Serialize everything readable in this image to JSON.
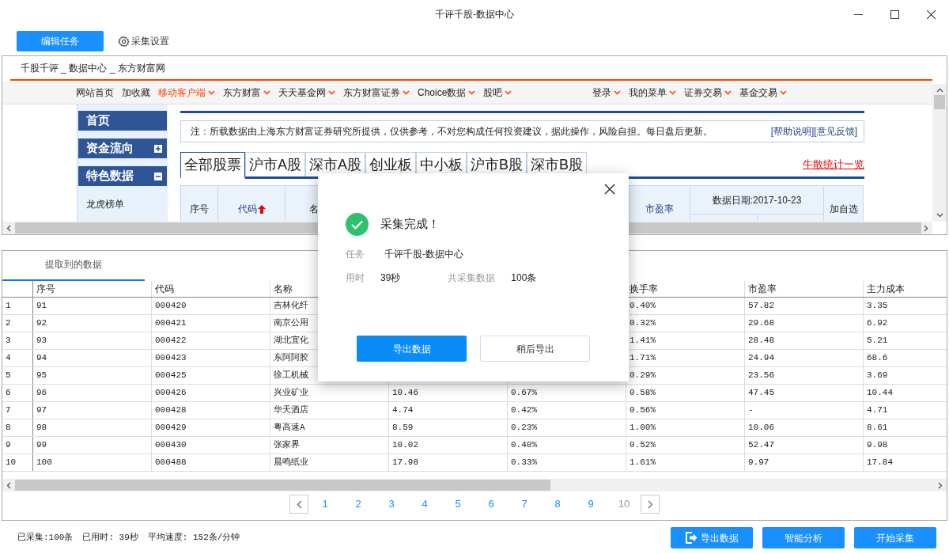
{
  "window": {
    "title": "千评千股-数据中心"
  },
  "toolbar": {
    "edit_button": "编辑任务",
    "settings_link": "采集设置"
  },
  "browser": {
    "page_title": "千股千评 _ 数据中心 _ 东方财富网",
    "nav_left": [
      {
        "label": "网站首页",
        "caret": false,
        "highlight": false
      },
      {
        "label": "加收藏",
        "caret": false,
        "highlight": false
      },
      {
        "label": "移动客户端",
        "caret": true,
        "highlight": true
      },
      {
        "label": "东方财富",
        "caret": true,
        "highlight": false
      },
      {
        "label": "天天基金网",
        "caret": true,
        "highlight": false
      },
      {
        "label": "东方财富证券",
        "caret": true,
        "highlight": false
      },
      {
        "label": "Choice数据",
        "caret": true,
        "highlight": false
      },
      {
        "label": "股吧",
        "caret": true,
        "highlight": false
      }
    ],
    "nav_right": [
      {
        "label": "登录",
        "caret": true,
        "highlight": false
      },
      {
        "label": "我的菜单",
        "caret": true,
        "highlight": false
      },
      {
        "label": "证券交易",
        "caret": true,
        "highlight": false
      },
      {
        "label": "基金交易",
        "caret": true,
        "highlight": false
      }
    ],
    "sidebar": [
      {
        "label": "首页",
        "kind": "header"
      },
      {
        "label": "资金流向",
        "kind": "header",
        "expanded": false
      },
      {
        "label": "特色数据",
        "kind": "header",
        "expanded": true
      },
      {
        "label": "龙虎榜单",
        "kind": "link"
      }
    ],
    "notice": "注：所载数据由上海东方财富证券研究所提供，仅供参考，不对您构成任何投资建议，据此操作，风险自担。每日盘后更新。",
    "notice_links": [
      "[帮助说明]",
      "[意见反馈]"
    ],
    "tabs": [
      {
        "label": "全部股票",
        "selected": true
      },
      {
        "label": "沪市A股",
        "selected": false
      },
      {
        "label": "深市A股",
        "selected": false
      },
      {
        "label": "创业板",
        "selected": false
      },
      {
        "label": "中小板",
        "selected": false
      },
      {
        "label": "沪市B股",
        "selected": false
      },
      {
        "label": "深市B股",
        "selected": false
      }
    ],
    "side_link": "牛散统计一览",
    "table_headers": [
      {
        "label": "序号",
        "kind": "plain"
      },
      {
        "label": "代码",
        "kind": "sorted"
      },
      {
        "label": "名",
        "kind": "plain"
      },
      {
        "label": "市盈率",
        "kind": "link"
      },
      {
        "label": "数据日期:2017-10-23",
        "kind": "group"
      },
      {
        "label": "加自选",
        "kind": "plain"
      }
    ]
  },
  "results": {
    "tab": "提取到的数据",
    "columns": [
      "",
      "序号",
      "代码",
      "名称",
      null,
      null,
      "换手率",
      "市盈率",
      "主力成本"
    ],
    "rows": [
      [
        "1",
        "91",
        "000420",
        "吉林化纤",
        null,
        null,
        "0.40%",
        "57.82",
        "3.35"
      ],
      [
        "2",
        "92",
        "000421",
        "南京公用",
        null,
        null,
        "0.32%",
        "29.68",
        "6.92"
      ],
      [
        "3",
        "93",
        "000422",
        "湖北宜化",
        null,
        null,
        "1.41%",
        "28.48",
        "5.21"
      ],
      [
        "4",
        "94",
        "000423",
        "东阿阿胶",
        null,
        null,
        "1.71%",
        "24.94",
        "68.6"
      ],
      [
        "5",
        "95",
        "000425",
        "徐工机械",
        null,
        null,
        "0.29%",
        "23.56",
        "3.69"
      ],
      [
        "6",
        "96",
        "000426",
        "兴业矿业",
        "10.46",
        "0.67%",
        "0.58%",
        "47.45",
        "10.44"
      ],
      [
        "7",
        "97",
        "000428",
        "华天酒店",
        "4.74",
        "0.42%",
        "0.56%",
        "-",
        "4.71"
      ],
      [
        "8",
        "98",
        "000429",
        "粤高速A",
        "8.59",
        "0.23%",
        "1.00%",
        "10.06",
        "8.61"
      ],
      [
        "9",
        "99",
        "000430",
        "张家界",
        "10.02",
        "0.40%",
        "0.52%",
        "52.47",
        "9.98"
      ],
      [
        "10",
        "100",
        "000488",
        "晨鸣纸业",
        "17.98",
        "0.33%",
        "1.61%",
        "9.97",
        "17.84"
      ]
    ],
    "pages": [
      {
        "label": "1",
        "selected": false
      },
      {
        "label": "2",
        "selected": false
      },
      {
        "label": "3",
        "selected": false
      },
      {
        "label": "4",
        "selected": false
      },
      {
        "label": "5",
        "selected": false
      },
      {
        "label": "6",
        "selected": false
      },
      {
        "label": "7",
        "selected": false
      },
      {
        "label": "8",
        "selected": false
      },
      {
        "label": "9",
        "selected": false
      },
      {
        "label": "10",
        "selected": true
      }
    ]
  },
  "status": [
    "已采集:100条",
    "已用时: 39秒",
    "平均速度: 152条/分钟"
  ],
  "actions": [
    {
      "label": "导出数据",
      "kind": "export"
    },
    {
      "label": "智能分析",
      "kind": "plain"
    },
    {
      "label": "开始采集",
      "kind": "plain"
    }
  ],
  "dialog": {
    "title": "采集完成！",
    "fields": [
      {
        "label": "任务",
        "value": "千评千股-数据中心"
      },
      {
        "label": "用时",
        "value": "39秒"
      },
      {
        "label": "共采集数据",
        "value": "100条"
      }
    ],
    "buttons": [
      {
        "label": "导出数据",
        "kind": "primary"
      },
      {
        "label": "稍后导出",
        "kind": "secondary"
      }
    ]
  }
}
